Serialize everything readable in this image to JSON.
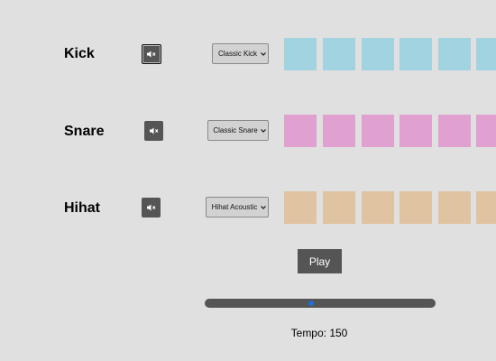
{
  "tracks": [
    {
      "name": "Kick",
      "sound": "Classic Kick",
      "mute_icon": "speaker-muted-icon",
      "step_color": "#a1d3e0",
      "steps_visible": 6
    },
    {
      "name": "Snare",
      "sound": "Classic Snare",
      "mute_icon": "speaker-muted-icon",
      "step_color": "#e0a1d0",
      "steps_visible": 6
    },
    {
      "name": "Hihat",
      "sound": "Hihat Acoustic",
      "mute_icon": "speaker-muted-icon",
      "step_color": "#e0c3a1",
      "steps_visible": 6
    }
  ],
  "controls": {
    "play_label": "Play",
    "tempo_text": "Tempo: 150",
    "tempo_slider_fraction": 0.46
  },
  "colors": {
    "background": "#e0e0e0",
    "button": "#555555",
    "slider_thumb": "#1e6fd9"
  }
}
